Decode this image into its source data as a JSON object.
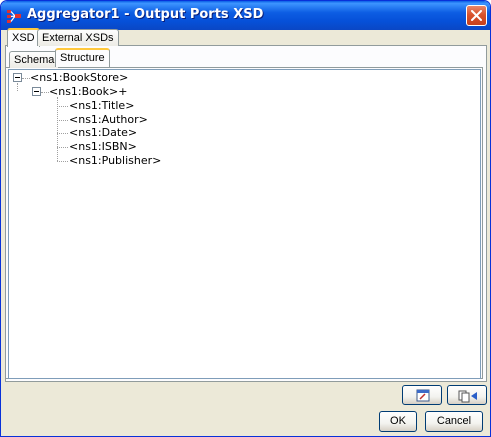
{
  "window": {
    "title": "Aggregator1 - Output Ports XSD"
  },
  "tabs": {
    "outer": [
      {
        "label": "XSD",
        "active": true
      },
      {
        "label": "External XSDs",
        "active": false
      }
    ],
    "inner": [
      {
        "label": "Schema",
        "active": false
      },
      {
        "label": "Structure",
        "active": true
      }
    ]
  },
  "tree": {
    "root": "<ns1:BookStore>",
    "child": "<ns1:Book>+",
    "leaves": [
      "<ns1:Title>",
      "<ns1:Author>",
      "<ns1:Date>",
      "<ns1:ISBN>",
      "<ns1:Publisher>"
    ]
  },
  "toolbar": {
    "icons": [
      "edit-schema-icon",
      "copy-back-icon"
    ]
  },
  "buttons": {
    "ok": "OK",
    "cancel": "Cancel"
  },
  "colors": {
    "titlebar": "#0a5fe6",
    "active_tab_accent": "#ffc83c",
    "close_button": "#d9532d"
  }
}
